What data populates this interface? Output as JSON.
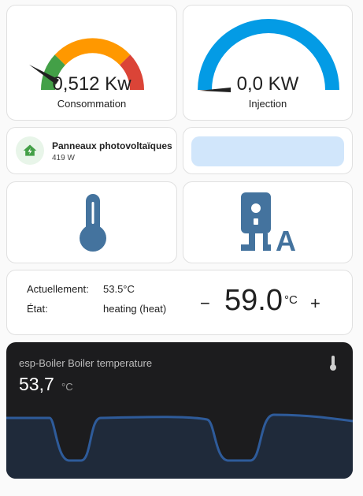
{
  "gauges": {
    "consumption": {
      "value_text": "0,512 Kw",
      "label": "Consommation",
      "fraction": 0.1
    },
    "injection": {
      "value_text": "0,0 KW",
      "label": "Injection",
      "fraction": 0.0
    }
  },
  "solar_tile": {
    "name": "Panneaux photovoltaïques",
    "state": "419 W",
    "icon": "solar-home-icon"
  },
  "thermostat": {
    "current_label": "Actuellement:",
    "current_value": "53.5°C",
    "state_label": "État:",
    "state_value": "heating (heat)",
    "minus": "−",
    "target": "59.0",
    "unit": "°C",
    "plus": "+"
  },
  "sensor_graph": {
    "title": "esp-Boiler Boiler temperature",
    "value": "53,7",
    "unit": "°C"
  },
  "colors": {
    "gauge_green": "#43a047",
    "gauge_orange": "#ff9800",
    "gauge_red": "#db4437",
    "gauge_blue": "#039be5",
    "icon_blue": "#44739e",
    "graph_line": "#2e5b9a"
  }
}
